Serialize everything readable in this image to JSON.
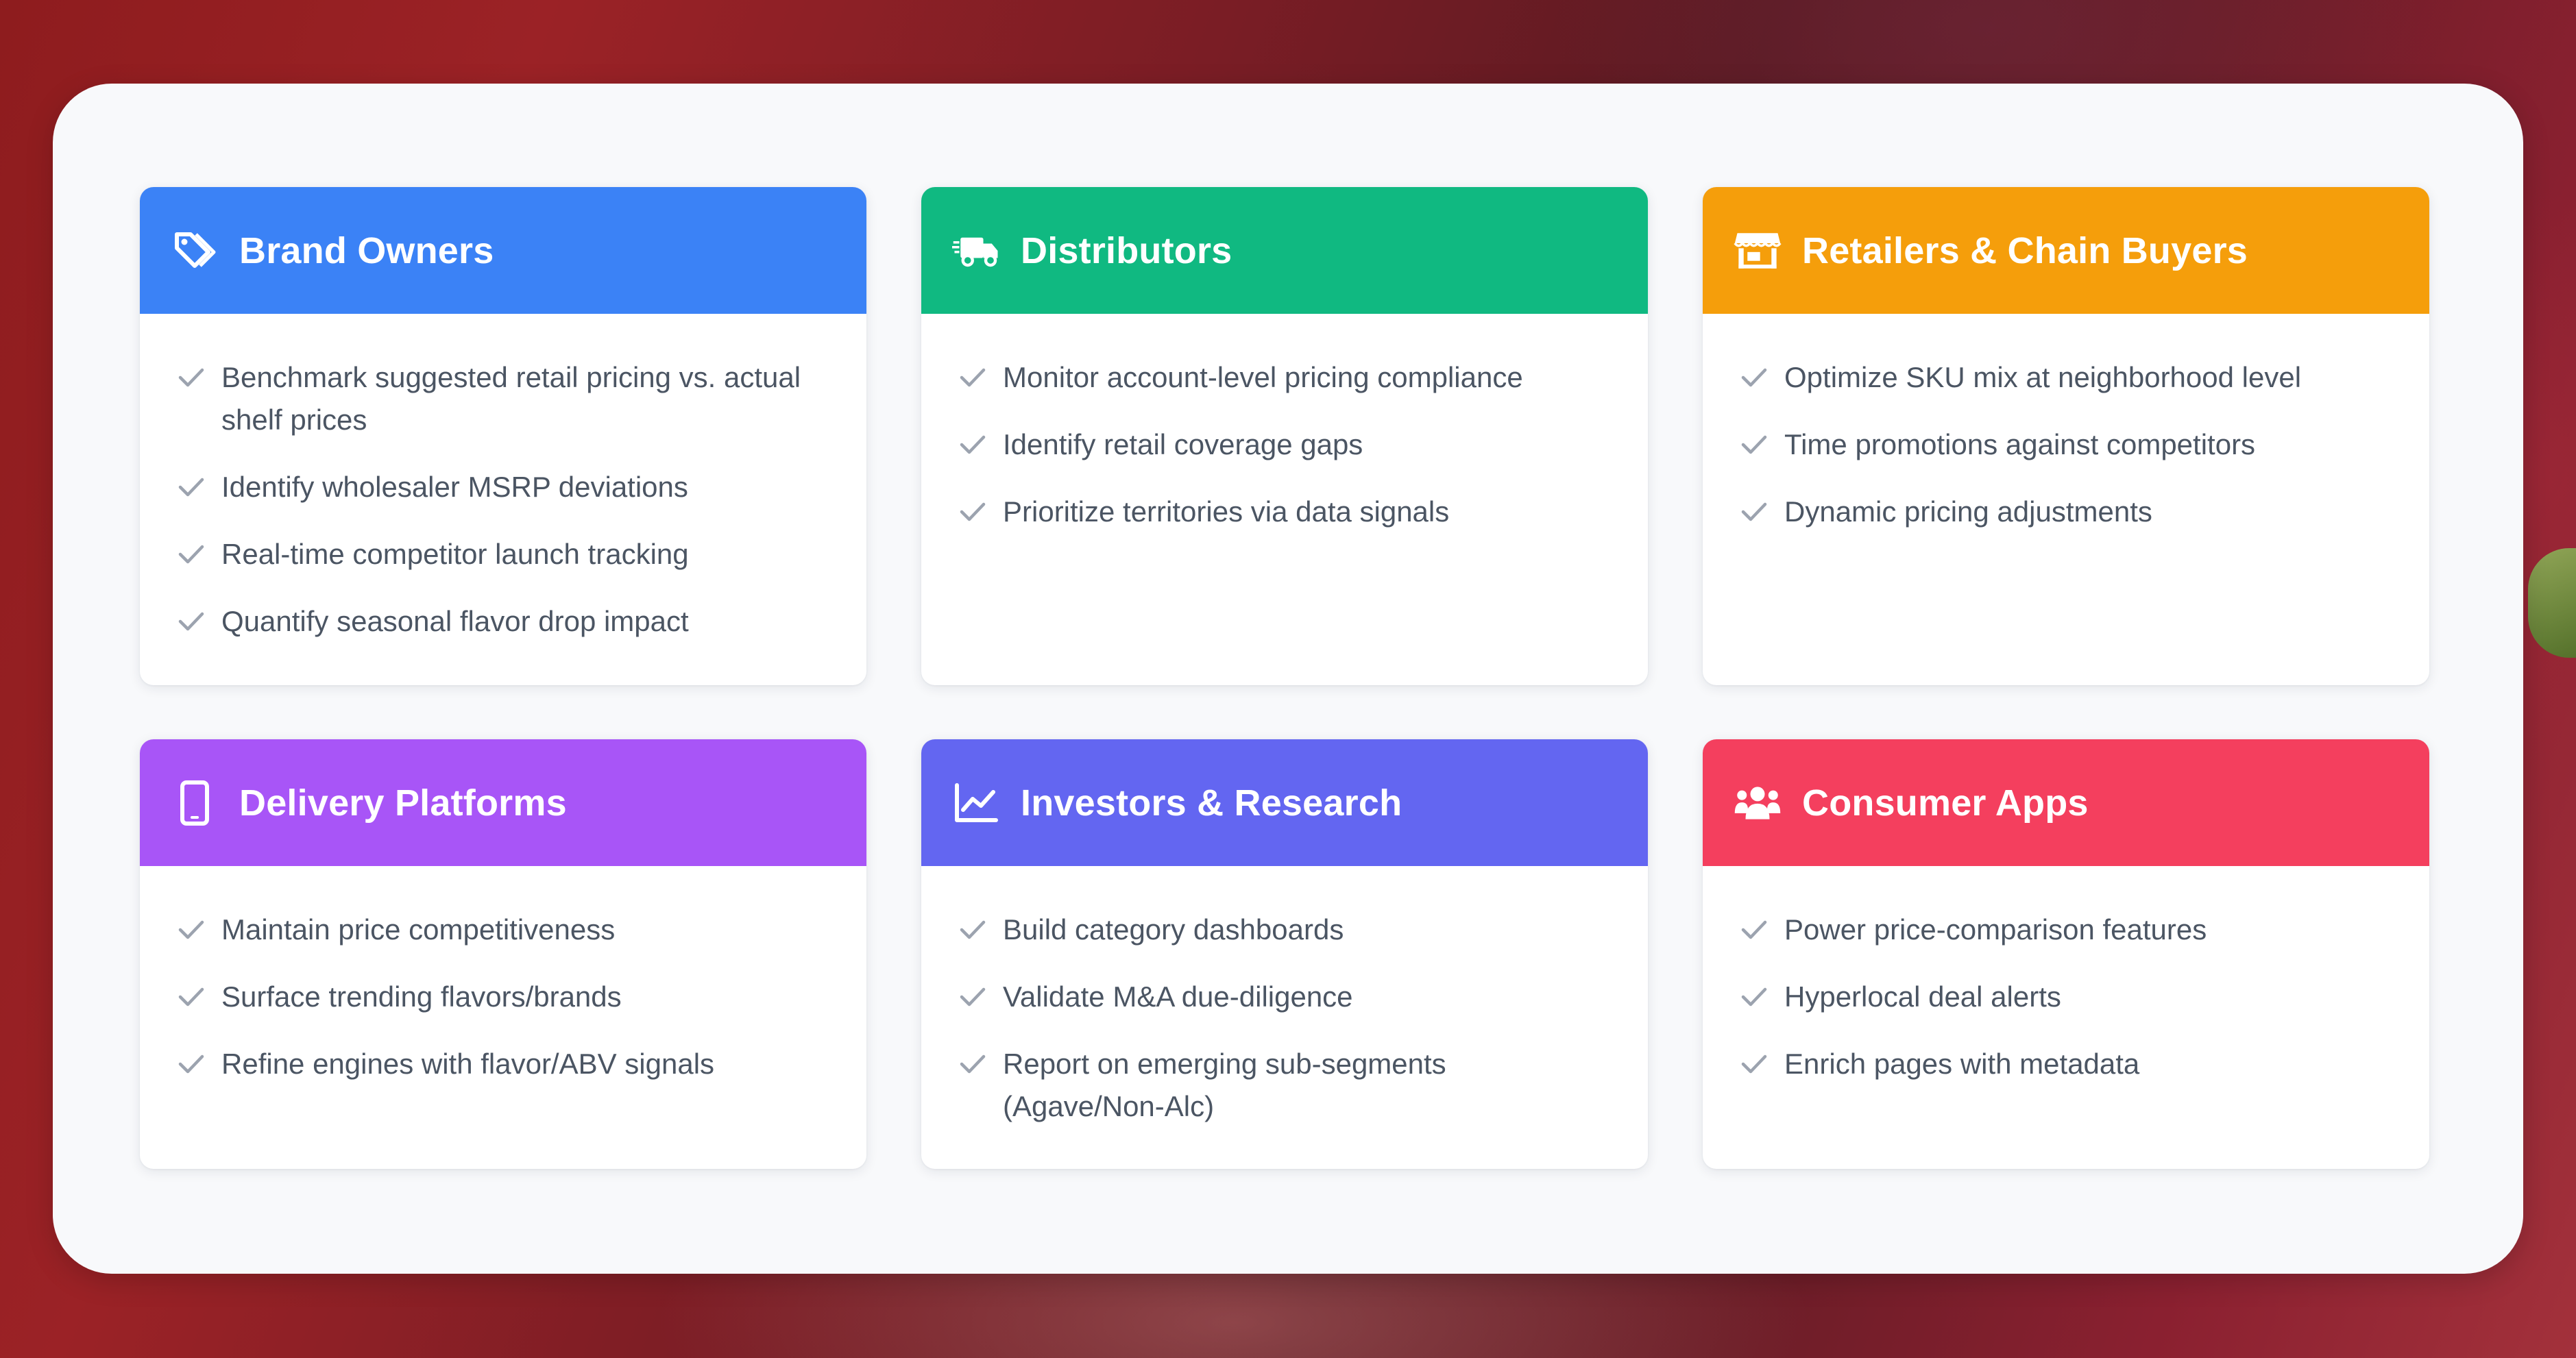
{
  "cards": [
    {
      "title": "Brand Owners",
      "icon": "tags-icon",
      "color": "#3b82f6",
      "items": [
        "Benchmark suggested retail pricing vs. actual shelf prices",
        "Identify wholesaler MSRP deviations",
        "Real-time competitor launch tracking",
        "Quantify seasonal flavor drop impact"
      ]
    },
    {
      "title": "Distributors",
      "icon": "delivery-truck-icon",
      "color": "#10b981",
      "items": [
        "Monitor account-level pricing compliance",
        "Identify retail coverage gaps",
        "Prioritize territories via data signals"
      ]
    },
    {
      "title": "Retailers & Chain Buyers",
      "icon": "store-icon",
      "color": "#f59e0b",
      "items": [
        "Optimize SKU mix at neighborhood level",
        "Time promotions against competitors",
        "Dynamic pricing adjustments"
      ]
    },
    {
      "title": "Delivery Platforms",
      "icon": "mobile-phone-icon",
      "color": "#a855f7",
      "items": [
        "Maintain price competitiveness",
        "Surface trending flavors/brands",
        "Refine engines with flavor/ABV signals"
      ]
    },
    {
      "title": "Investors & Research",
      "icon": "line-chart-icon",
      "color": "#6366f1",
      "items": [
        "Build category dashboards",
        "Validate M&A due-diligence",
        "Report on emerging sub-segments (Agave/Non-Alc)"
      ]
    },
    {
      "title": "Consumer Apps",
      "icon": "users-icon",
      "color": "#f43f5e",
      "items": [
        "Power price-comparison features",
        "Hyperlocal deal alerts",
        "Enrich pages with metadata"
      ]
    }
  ],
  "check_icon": "check-icon"
}
